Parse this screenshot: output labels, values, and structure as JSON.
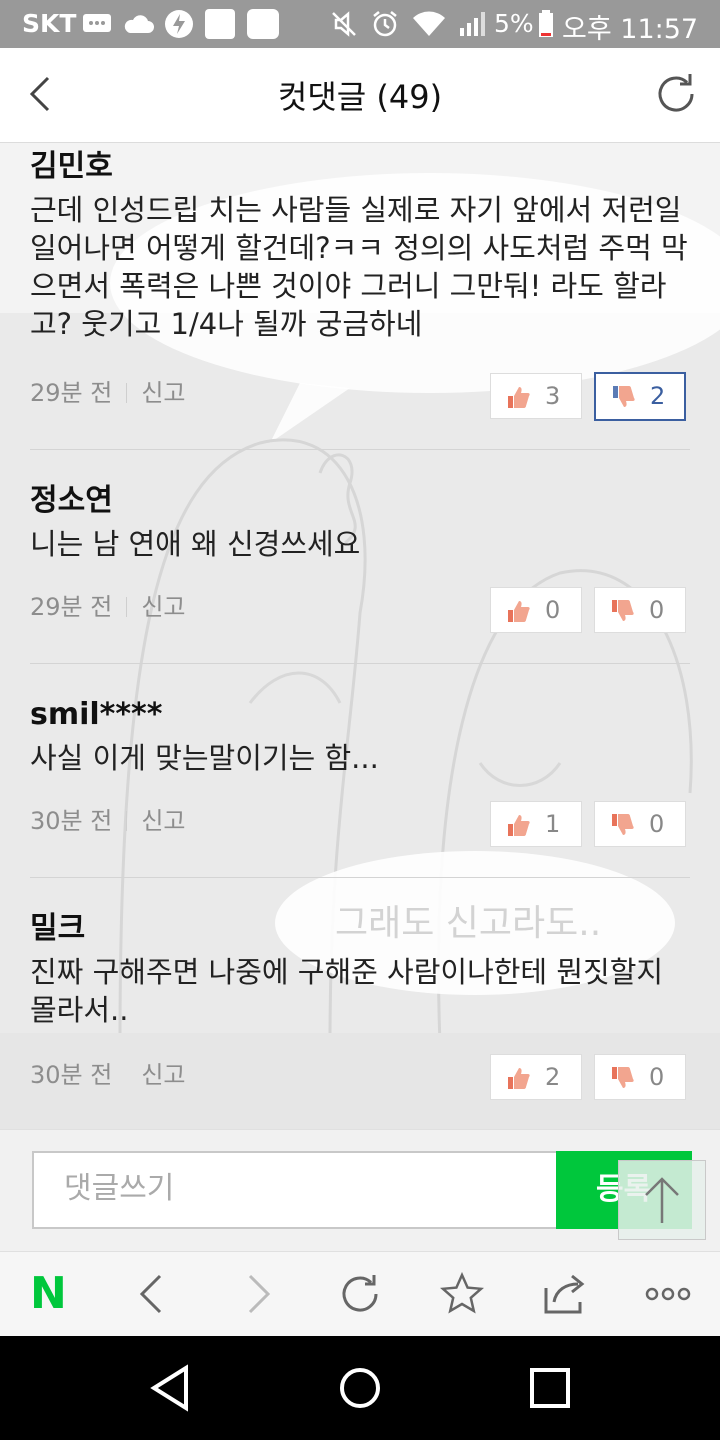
{
  "status_bar": {
    "carrier": "SKT",
    "battery": "5%",
    "time": "오후 11:57",
    "icons": [
      "message-icon",
      "cloud-icon",
      "bolt-icon",
      "square-icon",
      "square-icon",
      "mute-icon",
      "alarm-icon",
      "wifi-icon",
      "signal-icon",
      "battery-icon"
    ]
  },
  "header": {
    "title": "컷댓글 (49)",
    "back_icon": "chevron-left-icon",
    "refresh_icon": "refresh-icon"
  },
  "comments": [
    {
      "author": "김민호",
      "text": "근데 인성드립 치는 사람들 실제로 자기 앞에서 저런일 일어나면 어떻게 할건데?ㅋㅋ 정의의 사도처럼 주먹 막으면서 폭력은 나쁜 것이야 그러니 그만둬! 라도 할라고? 웃기고 1/4나 될까 궁금하네",
      "time": "29분 전",
      "report": "신고",
      "likes": "3",
      "dislikes": "2",
      "dislike_active": true
    },
    {
      "author": "정소연",
      "text": "니는 남 연애 왜 신경쓰세요",
      "time": "29분 전",
      "report": "신고",
      "likes": "0",
      "dislikes": "0",
      "dislike_active": false
    },
    {
      "author": "smil****",
      "text": "사실 이게 맞는말이기는 함...",
      "time": "30분 전",
      "report": "신고",
      "likes": "1",
      "dislikes": "0",
      "dislike_active": false
    },
    {
      "author": "밀크",
      "text": "진짜 구해주면 나중에 구해준 사람이나한테 뭔짓할지 몰라서..",
      "time": "30분 전",
      "report": "신고",
      "likes": "2",
      "dislikes": "0",
      "dislike_active": false
    }
  ],
  "background_art": {
    "speech_bubble_text": "그래도 신고라도.."
  },
  "input": {
    "placeholder": "댓글쓰기",
    "submit_label": "등록"
  },
  "toolbar": {
    "logo": "N",
    "items": [
      "back-icon",
      "forward-icon",
      "reload-icon",
      "star-icon",
      "share-icon",
      "more-icon"
    ]
  },
  "colors": {
    "accent_green": "#00c73c",
    "active_blue": "#3b5fa0",
    "status_bar": "#999999"
  }
}
